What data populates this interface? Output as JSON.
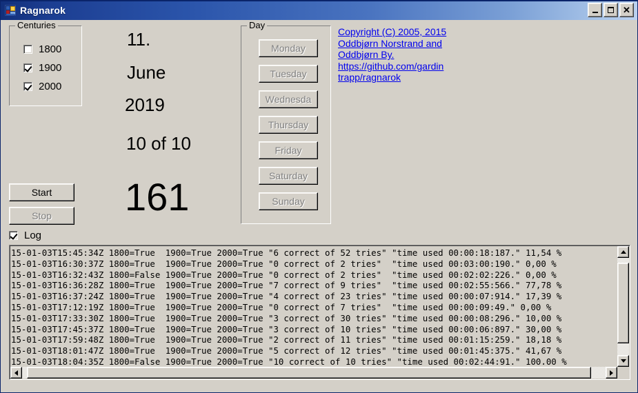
{
  "window": {
    "title": "Ragnarok",
    "icon": "application-form-icon",
    "controls": {
      "minimize": "_",
      "maximize": "□",
      "close": "✕"
    }
  },
  "centuries": {
    "legend": "Centuries",
    "items": [
      {
        "label": "1800",
        "checked": false
      },
      {
        "label": "1900",
        "checked": true
      },
      {
        "label": "2000",
        "checked": true
      }
    ]
  },
  "date_display": {
    "day": "11.",
    "month": "June",
    "year": "2019",
    "progress": "10 of 10",
    "score": "161"
  },
  "day_group": {
    "legend": "Day",
    "buttons": [
      {
        "label": "Monday",
        "enabled": false
      },
      {
        "label": "Tuesday",
        "enabled": false
      },
      {
        "label": "Wednesda",
        "enabled": false
      },
      {
        "label": "Thursday",
        "enabled": false
      },
      {
        "label": "Friday",
        "enabled": false
      },
      {
        "label": "Saturday",
        "enabled": false
      },
      {
        "label": "Sunday",
        "enabled": false
      }
    ]
  },
  "credits": {
    "line1": "Copyright (C) 2005, 2015",
    "line2": " Oddbjørn Norstrand and",
    "line3": "Oddbjørn By.",
    "line4": "https://github.com/gardin",
    "line5": "trapp/ragnarok",
    "link_color": "#0000ee"
  },
  "controls": {
    "start_label": "Start",
    "start_enabled": true,
    "stop_label": "Stop",
    "stop_enabled": false,
    "log_label": "Log",
    "log_checked": true
  },
  "log": {
    "lines": [
      "15-01-03T15:45:34Z 1800=True  1900=True 2000=True \"6 correct of 52 tries\" \"time used 00:00:18:187.\" 11,54 %",
      "15-01-03T16:30:37Z 1800=True  1900=True 2000=True \"0 correct of 2 tries\"  \"time used 00:03:00:190.\" 0,00 %",
      "15-01-03T16:32:43Z 1800=False 1900=True 2000=True \"0 correct of 2 tries\"  \"time used 00:02:02:226.\" 0,00 %",
      "15-01-03T16:36:28Z 1800=True  1900=True 2000=True \"7 correct of 9 tries\"  \"time used 00:02:55:566.\" 77,78 %",
      "15-01-03T16:37:24Z 1800=True  1900=True 2000=True \"4 correct of 23 tries\" \"time used 00:00:07:914.\" 17,39 %",
      "15-01-03T17:12:19Z 1800=True  1900=True 2000=True \"0 correct of 7 tries\"  \"time used 00:00:09:49.\" 0,00 %",
      "15-01-03T17:33:30Z 1800=True  1900=True 2000=True \"3 correct of 30 tries\" \"time used 00:00:08:296.\" 10,00 %",
      "15-01-03T17:45:37Z 1800=True  1900=True 2000=True \"3 correct of 10 tries\" \"time used 00:00:06:897.\" 30,00 %",
      "15-01-03T17:59:48Z 1800=True  1900=True 2000=True \"2 correct of 11 tries\" \"time used 00:01:15:259.\" 18,18 %",
      "15-01-03T18:01:47Z 1800=True  1900=True 2000=True \"5 correct of 12 tries\" \"time used 00:01:45:375.\" 41,67 %",
      "15-01-03T18:04:35Z 1800=False 1900=True 2000=True \"10 correct of 10 tries\" \"time used 00:02:44:91.\" 100,00 %"
    ]
  },
  "theme": {
    "window_bg": "#d4d0c8",
    "title_start": "#12307b",
    "title_end": "#bcd2f0",
    "text": "#000000",
    "disabled_text": "#808080"
  }
}
